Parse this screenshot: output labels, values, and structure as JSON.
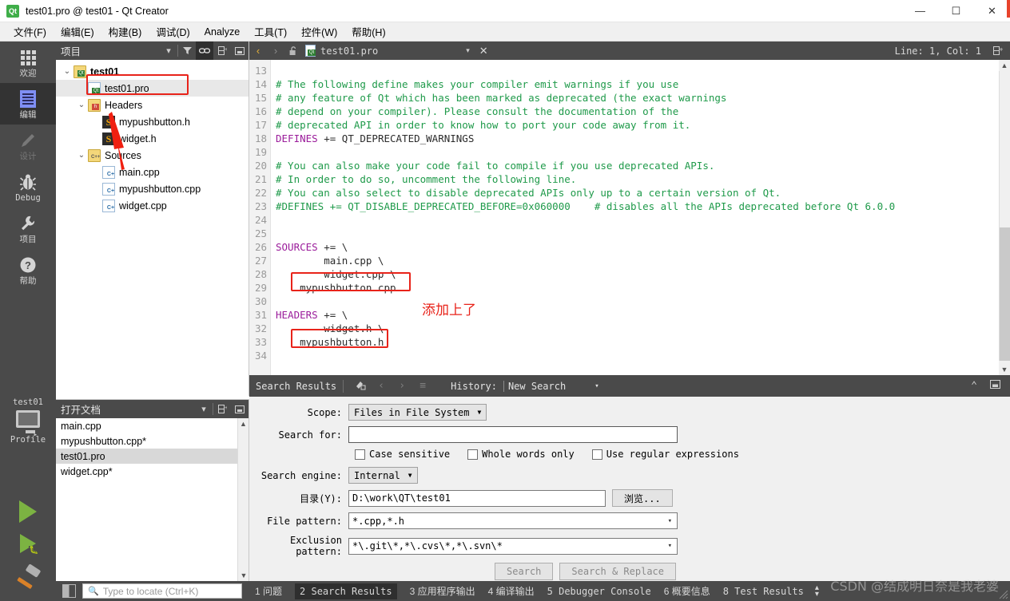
{
  "window": {
    "title": "test01.pro @ test01 - Qt Creator",
    "app_icon": "qt-logo-icon",
    "minimize": "—",
    "maximize": "☐",
    "close": "✕"
  },
  "menubar": {
    "items": [
      {
        "text": "文件(F)",
        "name": "menu-file"
      },
      {
        "text": "编辑(E)",
        "name": "menu-edit"
      },
      {
        "text": "构建(B)",
        "name": "menu-build"
      },
      {
        "text": "调试(D)",
        "name": "menu-debug"
      },
      {
        "text": "Analyze",
        "name": "menu-analyze"
      },
      {
        "text": "工具(T)",
        "name": "menu-tools"
      },
      {
        "text": "控件(W)",
        "name": "menu-widget"
      },
      {
        "text": "帮助(H)",
        "name": "menu-help"
      }
    ]
  },
  "modebar": {
    "items": [
      {
        "label": "欢迎",
        "icon": "grid-icon",
        "state": "normal"
      },
      {
        "label": "编辑",
        "icon": "document-icon",
        "state": "active"
      },
      {
        "label": "设计",
        "icon": "pencil-icon",
        "state": "disabled"
      },
      {
        "label": "Debug",
        "icon": "bug-icon",
        "state": "normal"
      },
      {
        "label": "项目",
        "icon": "wrench-icon",
        "state": "normal"
      },
      {
        "label": "帮助",
        "icon": "question-icon",
        "state": "normal"
      }
    ],
    "kit": {
      "project": "test01",
      "build_config": "Profile",
      "icon": "monitor-icon",
      "arrow": "▸"
    },
    "run_buttons": [
      {
        "name": "run-button",
        "icon": "play-icon"
      },
      {
        "name": "debug-button",
        "icon": "play-debug-icon"
      },
      {
        "name": "build-button",
        "icon": "hammer-icon"
      }
    ]
  },
  "project_panel": {
    "title": "项目",
    "header_buttons": [
      {
        "name": "filter-icon",
        "glyph": "▼"
      },
      {
        "name": "funnel-icon",
        "glyph": "ᶠ"
      },
      {
        "name": "link-icon",
        "glyph": "⚭",
        "active": true
      },
      {
        "name": "split-icon",
        "glyph": "⊞"
      },
      {
        "name": "collapse-icon",
        "glyph": "⬒"
      }
    ],
    "tree": [
      {
        "label": "test01",
        "depth": 0,
        "icon": "project-folder-icon",
        "twist": "⌄",
        "bold": true,
        "selected": false
      },
      {
        "label": "test01.pro",
        "depth": 1,
        "icon": "pro-file-icon",
        "twist": "",
        "bold": false,
        "selected": true
      },
      {
        "label": "Headers",
        "depth": 1,
        "icon": "headers-folder-icon",
        "twist": "⌄",
        "bold": false,
        "selected": false
      },
      {
        "label": "mypushbutton.h",
        "depth": 2,
        "icon": "header-file-icon",
        "twist": "",
        "bold": false,
        "selected": false
      },
      {
        "label": "widget.h",
        "depth": 2,
        "icon": "header-file-icon",
        "twist": "",
        "bold": false,
        "selected": false
      },
      {
        "label": "Sources",
        "depth": 1,
        "icon": "sources-folder-icon",
        "twist": "⌄",
        "bold": false,
        "selected": false
      },
      {
        "label": "main.cpp",
        "depth": 2,
        "icon": "cpp-file-icon",
        "twist": "",
        "bold": false,
        "selected": false
      },
      {
        "label": "mypushbutton.cpp",
        "depth": 2,
        "icon": "cpp-file-icon",
        "twist": "",
        "bold": false,
        "selected": false
      },
      {
        "label": "widget.cpp",
        "depth": 2,
        "icon": "cpp-file-icon",
        "twist": "",
        "bold": false,
        "selected": false
      }
    ]
  },
  "docs_panel": {
    "title": "打开文档",
    "header_buttons": [
      {
        "name": "dropdown-icon",
        "glyph": "▼"
      },
      {
        "name": "split-icon",
        "glyph": "⊞"
      },
      {
        "name": "close-split-icon",
        "glyph": "⬒"
      }
    ],
    "items": [
      {
        "label": "main.cpp",
        "selected": false
      },
      {
        "label": "mypushbutton.cpp*",
        "selected": false
      },
      {
        "label": "test01.pro",
        "selected": true
      },
      {
        "label": "widget.cpp*",
        "selected": false
      }
    ]
  },
  "editor_toolbar": {
    "back": "‹",
    "forward": "›",
    "lock_icon": "unlock-icon",
    "file_icon": "pro-file-icon",
    "filename": "test01.pro",
    "dropdown": "▾",
    "close": "✕",
    "cursor_position": "Line: 1, Col: 1",
    "split_icon": "⊞"
  },
  "editor": {
    "lines": [
      {
        "no": "13",
        "segments": []
      },
      {
        "no": "14",
        "segments": [
          {
            "t": "# The following define makes your compiler emit warnings if you use",
            "c": "cmt"
          }
        ]
      },
      {
        "no": "15",
        "segments": [
          {
            "t": "# any feature of Qt which has been marked as deprecated (the exact warnings",
            "c": "cmt"
          }
        ]
      },
      {
        "no": "16",
        "segments": [
          {
            "t": "# depend on your compiler). Please consult the documentation of the",
            "c": "cmt"
          }
        ]
      },
      {
        "no": "17",
        "segments": [
          {
            "t": "# deprecated API in order to know how to port your code away from it.",
            "c": "cmt"
          }
        ]
      },
      {
        "no": "18",
        "segments": [
          {
            "t": "DEFINES",
            "c": "kw"
          },
          {
            "t": " += QT_DEPRECATED_WARNINGS",
            "c": "txt"
          }
        ]
      },
      {
        "no": "19",
        "segments": []
      },
      {
        "no": "20",
        "segments": [
          {
            "t": "# You can also make your code fail to compile if you use deprecated APIs.",
            "c": "cmt"
          }
        ]
      },
      {
        "no": "21",
        "segments": [
          {
            "t": "# In order to do so, uncomment the following line.",
            "c": "cmt"
          }
        ]
      },
      {
        "no": "22",
        "segments": [
          {
            "t": "# You can also select to disable deprecated APIs only up to a certain version of Qt.",
            "c": "cmt"
          }
        ]
      },
      {
        "no": "23",
        "segments": [
          {
            "t": "#DEFINES += QT_DISABLE_DEPRECATED_BEFORE=0x060000    # disables all the APIs deprecated before Qt 6.0.0",
            "c": "cmt"
          }
        ]
      },
      {
        "no": "24",
        "segments": []
      },
      {
        "no": "25",
        "segments": []
      },
      {
        "no": "26",
        "segments": [
          {
            "t": "SOURCES",
            "c": "kw"
          },
          {
            "t": " += \\",
            "c": "txt"
          }
        ]
      },
      {
        "no": "27",
        "segments": [
          {
            "t": "        main.cpp \\",
            "c": "txt"
          }
        ]
      },
      {
        "no": "28",
        "segments": [
          {
            "t": "        widget.cpp \\",
            "c": "txt"
          }
        ]
      },
      {
        "no": "29",
        "segments": [
          {
            "t": "    mypushbutton.cpp",
            "c": "txt"
          }
        ]
      },
      {
        "no": "30",
        "segments": []
      },
      {
        "no": "31",
        "segments": [
          {
            "t": "HEADERS",
            "c": "kw"
          },
          {
            "t": " += \\",
            "c": "txt"
          }
        ]
      },
      {
        "no": "32",
        "segments": [
          {
            "t": "        widget.h \\",
            "c": "txt"
          }
        ]
      },
      {
        "no": "33",
        "segments": [
          {
            "t": "    mypushbutton.h",
            "c": "txt"
          }
        ]
      },
      {
        "no": "34",
        "segments": []
      }
    ],
    "annotation_text": "添加上了",
    "annotation_color": "#e8231a"
  },
  "search_panel": {
    "title": "Search Results",
    "toolbar_icons": [
      {
        "name": "clear-icon",
        "glyph": "⚒"
      },
      {
        "name": "prev-result-icon",
        "glyph": "‹"
      },
      {
        "name": "next-result-icon",
        "glyph": "›"
      },
      {
        "name": "expand-all-icon",
        "glyph": "≡"
      }
    ],
    "history_label": "History:",
    "history_value": "New Search",
    "history_arrow": "▾",
    "collapse_icon": "⌃",
    "close_icon": "⬒",
    "scope_label": "Scope:",
    "scope_value": "Files in File System",
    "search_for_label": "Search for:",
    "search_for_value": "",
    "checkboxes": [
      {
        "label": "Case sensitive",
        "checked": false,
        "name": "case-sensitive-checkbox"
      },
      {
        "label": "Whole words only",
        "checked": false,
        "name": "whole-words-checkbox"
      },
      {
        "label": "Use regular expressions",
        "checked": false,
        "name": "regex-checkbox"
      }
    ],
    "engine_label": "Search engine:",
    "engine_value": "Internal",
    "directory_label": "目录(Y):",
    "directory_value": "D:\\work\\QT\\test01",
    "browse_button": "浏览...",
    "file_pattern_label": "File pattern:",
    "file_pattern_value": "*.cpp,*.h",
    "exclusion_label": "Exclusion pattern:",
    "exclusion_value": "*\\.git\\*,*\\.cvs\\*,*\\.svn\\*",
    "search_button": "Search",
    "search_replace_button": "Search & Replace"
  },
  "statusbar": {
    "toggle_icon": "sidebar-toggle-icon",
    "locator_placeholder": "Type to locate (Ctrl+K)",
    "locator_icon": "search-icon",
    "items": [
      {
        "label": "1 问题",
        "active": false,
        "mono": false
      },
      {
        "label": "2 Search Results",
        "active": true,
        "mono": true
      },
      {
        "label": "3 应用程序输出",
        "active": false,
        "mono": false
      },
      {
        "label": "4 编译输出",
        "active": false,
        "mono": false
      },
      {
        "label": "5 Debugger Console",
        "active": false,
        "mono": true
      },
      {
        "label": "6 概要信息",
        "active": false,
        "mono": false
      },
      {
        "label": "8 Test Results",
        "active": false,
        "mono": true
      }
    ],
    "arrows": "⬍",
    "watermark": "CSDN @结成明日奈是我老婆"
  }
}
